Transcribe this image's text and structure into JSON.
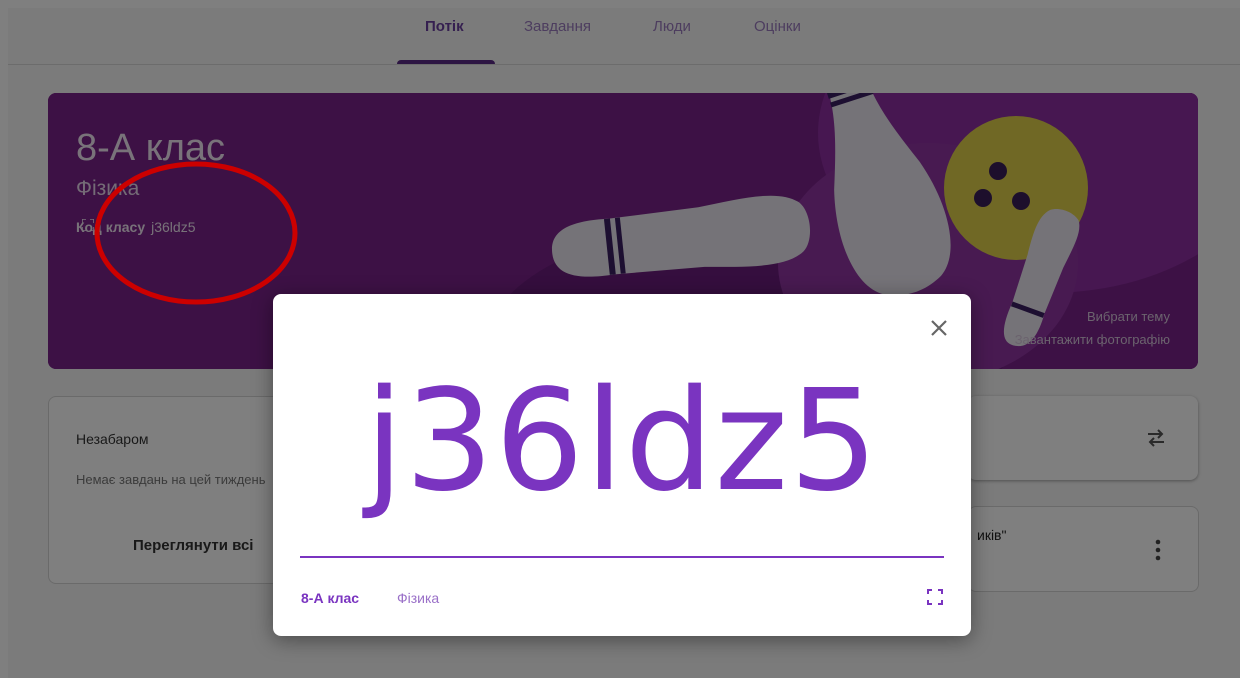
{
  "nav": {
    "tabs": [
      {
        "label": "Потік"
      },
      {
        "label": "Завдання"
      },
      {
        "label": "Люди"
      },
      {
        "label": "Оцінки"
      }
    ]
  },
  "banner": {
    "title": "8-А клас",
    "subject": "Фізика",
    "code_label": "Код класу",
    "code_value": "j36ldz5",
    "choose_theme": "Вибрати тему",
    "upload_photo": "Завантажити фотографію"
  },
  "upcoming": {
    "title": "Незабаром",
    "empty_text": "Немає завдань на цей тиждень",
    "view_all": "Переглянути всі"
  },
  "right_card": {
    "text_fragment": "иків\""
  },
  "modal": {
    "code": "j36ldz5",
    "class_name": "8-А клас",
    "subject": "Фізика"
  },
  "colors": {
    "accent": "#7a34c0",
    "banner": "#7a238a",
    "annotation": "#cc0000"
  },
  "icons": {
    "close": "close-icon",
    "fullscreen": "fullscreen-icon",
    "swap": "swap-icon",
    "more": "more-vert-icon"
  }
}
